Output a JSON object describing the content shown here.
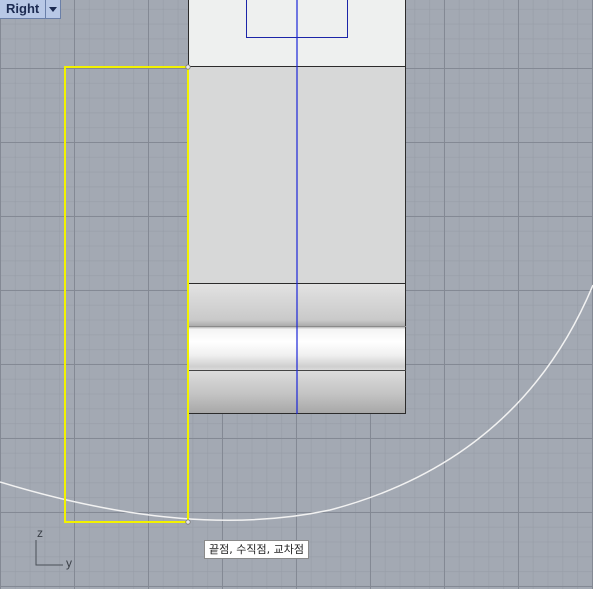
{
  "viewport": {
    "title": "Right",
    "menu_icon": "triangle-down-icon"
  },
  "snap_tooltip": {
    "text": "끝점, 수직점, 교차점"
  },
  "axes": {
    "z_label": "z",
    "y_label": "y"
  },
  "colors": {
    "grid_background": "#a3a9b3",
    "selection_yellow": "#f2f200",
    "construction_line_blue": "#1b25d8",
    "arc_white": "#f2f2f2",
    "tab_background": "#b8c8e6"
  }
}
